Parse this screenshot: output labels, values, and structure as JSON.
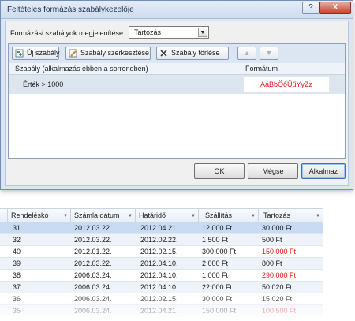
{
  "dialog": {
    "title": "Feltételes formázás szabálykezelője",
    "help_label": "?",
    "close_label": "X",
    "show_rules_label": "Formázási szabályok megjelenítése:",
    "show_rules_value": "Tartozás",
    "toolbar": {
      "new_rule": "Új szabály",
      "edit_rule": "Szabály szerkesztése",
      "delete_rule": "Szabály törlése",
      "move_up": "▲",
      "move_down": "▼"
    },
    "list": {
      "col_rule": "Szabály (alkalmazás ebben a sorrendben)",
      "col_format": "Formátum",
      "rules": [
        {
          "condition": "Érték > 1000",
          "format_preview": "AáBbÖőÜűYyZz"
        }
      ]
    },
    "buttons": {
      "ok": "OK",
      "cancel": "Mégse",
      "apply": "Alkalmaz"
    }
  },
  "sheet": {
    "columns": [
      "Rendeléskó",
      "Számla dátum",
      "Határidő",
      "Szállítás",
      "Tartozás"
    ],
    "rows": [
      [
        "31",
        "2012.03.22.",
        "2012.04.21.",
        "12 000 Ft",
        "30 000 Ft"
      ],
      [
        "32",
        "2012.03.22.",
        "2012.02.22.",
        "1 500 Ft",
        "500 Ft"
      ],
      [
        "40",
        "2012.01.22.",
        "2012.02.15.",
        "300 000 Ft",
        "150 000 Ft"
      ],
      [
        "39",
        "2012.03.22.",
        "2012.04.10.",
        "2 000 Ft",
        "800 Ft"
      ],
      [
        "38",
        "2006.03.24.",
        "2012.04.10.",
        "1 000 Ft",
        "290 000 Ft"
      ],
      [
        "37",
        "2006.03.24.",
        "2012.04.10.",
        "22 000 Ft",
        "50 020 Ft"
      ],
      [
        "36",
        "2006.03.24.",
        "2012.02.15.",
        "30 000 Ft",
        "15 020 Ft"
      ],
      [
        "35",
        "2006.03.24.",
        "2012.04.21.",
        "150 000 Ft",
        "100 500 Ft"
      ]
    ],
    "highlight_color": "#e21919"
  }
}
